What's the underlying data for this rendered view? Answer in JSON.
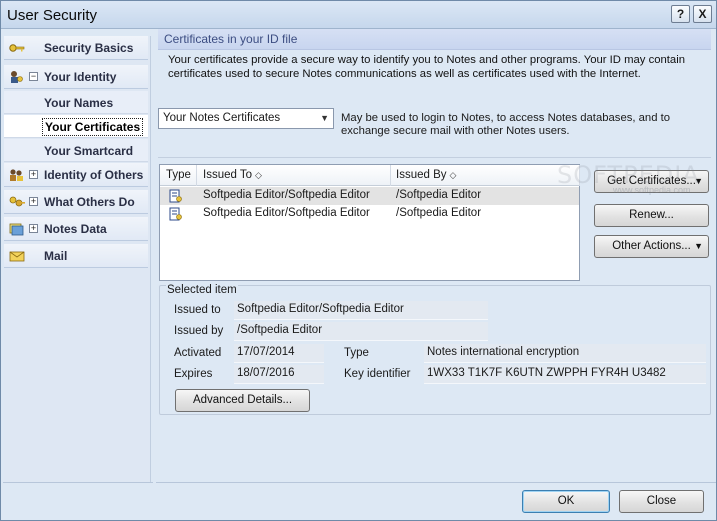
{
  "window": {
    "title": "User Security",
    "help_label": "?",
    "close_label": "X"
  },
  "sidebar": {
    "items": [
      {
        "label": "Security Basics",
        "icon": "key-icon",
        "expandable": false
      },
      {
        "label": "Your Identity",
        "icon": "identity-icon",
        "expandable": true,
        "expanded": true
      },
      {
        "label": "Your Names",
        "sub": true
      },
      {
        "label": "Your Certificates",
        "sub": true,
        "selected": true
      },
      {
        "label": "Your Smartcard",
        "sub": true
      },
      {
        "label": "Identity of Others",
        "icon": "people-keys-icon",
        "expandable": true
      },
      {
        "label": "What Others Do",
        "icon": "keys-icon",
        "expandable": true
      },
      {
        "label": "Notes Data",
        "icon": "notes-data-icon",
        "expandable": true
      },
      {
        "label": "Mail",
        "icon": "mail-icon",
        "expandable": false
      }
    ]
  },
  "main": {
    "section_title": "Certificates in your ID file",
    "intro": "Your certificates provide a secure way to identify you to Notes and other programs. Your ID may contain certificates used to secure Notes communications as well as certificates used with the Internet.",
    "cert_type_select": {
      "value": "Your Notes Certificates"
    },
    "cert_type_description": "May be used to login to Notes, to access Notes databases, and to exchange secure mail with other Notes users.",
    "table": {
      "columns": [
        "Type",
        "Issued To",
        "Issued By"
      ],
      "rows": [
        {
          "issued_to": "Softpedia Editor/Softpedia Editor",
          "issued_by": "/Softpedia Editor",
          "selected": true
        },
        {
          "issued_to": "Softpedia Editor/Softpedia Editor",
          "issued_by": "/Softpedia Editor",
          "selected": false
        }
      ]
    },
    "buttons": {
      "get_certificates": "Get Certificates...",
      "renew": "Renew...",
      "other_actions": "Other Actions..."
    },
    "selected_item": {
      "legend": "Selected item",
      "issued_to_label": "Issued to",
      "issued_to": "Softpedia Editor/Softpedia Editor",
      "issued_by_label": "Issued by",
      "issued_by": "/Softpedia Editor",
      "activated_label": "Activated",
      "activated": "17/07/2014",
      "expires_label": "Expires",
      "expires": "18/07/2016",
      "type_label": "Type",
      "type": "Notes international encryption",
      "key_identifier_label": "Key identifier",
      "key_identifier": "1WX33 T1K7F K6UTN ZWPPH FYR4H U3482",
      "advanced_details": "Advanced Details..."
    }
  },
  "footer": {
    "ok": "OK",
    "close": "Close"
  },
  "watermark": {
    "text": "SOFTPEDIA",
    "url": "www.softpedia.com"
  },
  "colors": {
    "window_bg": "#dde8f4",
    "section_title_text": "#3c4d82",
    "selected_row": "#e3e3e3"
  }
}
